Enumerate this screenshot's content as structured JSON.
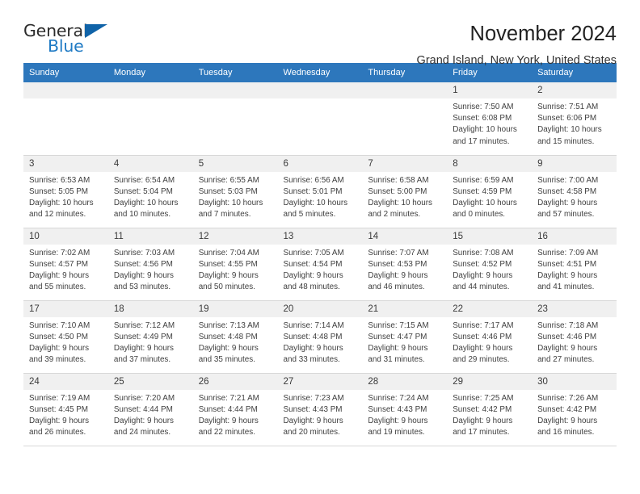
{
  "brand": {
    "name_top": "General",
    "name_bottom": "Blue",
    "triangle_color": "#1063a8",
    "blue_color": "#1f7ac4"
  },
  "header": {
    "title": "November 2024",
    "subtitle": "Grand Island, New York, United States"
  },
  "theme": {
    "header_bg": "#2d77bc",
    "daynum_bg": "#f0f0f0",
    "grid_line": "#d8d8d8",
    "text": "#3f3f3f"
  },
  "weekday_headers": [
    "Sunday",
    "Monday",
    "Tuesday",
    "Wednesday",
    "Thursday",
    "Friday",
    "Saturday"
  ],
  "labels": {
    "sunrise_prefix": "Sunrise:",
    "sunset_prefix": "Sunset:",
    "daylight_prefix": "Daylight:"
  },
  "weeks": [
    [
      {
        "day": "",
        "blank": true
      },
      {
        "day": "",
        "blank": true
      },
      {
        "day": "",
        "blank": true
      },
      {
        "day": "",
        "blank": true
      },
      {
        "day": "",
        "blank": true
      },
      {
        "day": "1",
        "sunrise": "Sunrise: 7:50 AM",
        "sunset": "Sunset: 6:08 PM",
        "daylight_l1": "Daylight: 10 hours",
        "daylight_l2": "and 17 minutes."
      },
      {
        "day": "2",
        "sunrise": "Sunrise: 7:51 AM",
        "sunset": "Sunset: 6:06 PM",
        "daylight_l1": "Daylight: 10 hours",
        "daylight_l2": "and 15 minutes."
      }
    ],
    [
      {
        "day": "3",
        "sunrise": "Sunrise: 6:53 AM",
        "sunset": "Sunset: 5:05 PM",
        "daylight_l1": "Daylight: 10 hours",
        "daylight_l2": "and 12 minutes."
      },
      {
        "day": "4",
        "sunrise": "Sunrise: 6:54 AM",
        "sunset": "Sunset: 5:04 PM",
        "daylight_l1": "Daylight: 10 hours",
        "daylight_l2": "and 10 minutes."
      },
      {
        "day": "5",
        "sunrise": "Sunrise: 6:55 AM",
        "sunset": "Sunset: 5:03 PM",
        "daylight_l1": "Daylight: 10 hours",
        "daylight_l2": "and 7 minutes."
      },
      {
        "day": "6",
        "sunrise": "Sunrise: 6:56 AM",
        "sunset": "Sunset: 5:01 PM",
        "daylight_l1": "Daylight: 10 hours",
        "daylight_l2": "and 5 minutes."
      },
      {
        "day": "7",
        "sunrise": "Sunrise: 6:58 AM",
        "sunset": "Sunset: 5:00 PM",
        "daylight_l1": "Daylight: 10 hours",
        "daylight_l2": "and 2 minutes."
      },
      {
        "day": "8",
        "sunrise": "Sunrise: 6:59 AM",
        "sunset": "Sunset: 4:59 PM",
        "daylight_l1": "Daylight: 10 hours",
        "daylight_l2": "and 0 minutes."
      },
      {
        "day": "9",
        "sunrise": "Sunrise: 7:00 AM",
        "sunset": "Sunset: 4:58 PM",
        "daylight_l1": "Daylight: 9 hours",
        "daylight_l2": "and 57 minutes."
      }
    ],
    [
      {
        "day": "10",
        "sunrise": "Sunrise: 7:02 AM",
        "sunset": "Sunset: 4:57 PM",
        "daylight_l1": "Daylight: 9 hours",
        "daylight_l2": "and 55 minutes."
      },
      {
        "day": "11",
        "sunrise": "Sunrise: 7:03 AM",
        "sunset": "Sunset: 4:56 PM",
        "daylight_l1": "Daylight: 9 hours",
        "daylight_l2": "and 53 minutes."
      },
      {
        "day": "12",
        "sunrise": "Sunrise: 7:04 AM",
        "sunset": "Sunset: 4:55 PM",
        "daylight_l1": "Daylight: 9 hours",
        "daylight_l2": "and 50 minutes."
      },
      {
        "day": "13",
        "sunrise": "Sunrise: 7:05 AM",
        "sunset": "Sunset: 4:54 PM",
        "daylight_l1": "Daylight: 9 hours",
        "daylight_l2": "and 48 minutes."
      },
      {
        "day": "14",
        "sunrise": "Sunrise: 7:07 AM",
        "sunset": "Sunset: 4:53 PM",
        "daylight_l1": "Daylight: 9 hours",
        "daylight_l2": "and 46 minutes."
      },
      {
        "day": "15",
        "sunrise": "Sunrise: 7:08 AM",
        "sunset": "Sunset: 4:52 PM",
        "daylight_l1": "Daylight: 9 hours",
        "daylight_l2": "and 44 minutes."
      },
      {
        "day": "16",
        "sunrise": "Sunrise: 7:09 AM",
        "sunset": "Sunset: 4:51 PM",
        "daylight_l1": "Daylight: 9 hours",
        "daylight_l2": "and 41 minutes."
      }
    ],
    [
      {
        "day": "17",
        "sunrise": "Sunrise: 7:10 AM",
        "sunset": "Sunset: 4:50 PM",
        "daylight_l1": "Daylight: 9 hours",
        "daylight_l2": "and 39 minutes."
      },
      {
        "day": "18",
        "sunrise": "Sunrise: 7:12 AM",
        "sunset": "Sunset: 4:49 PM",
        "daylight_l1": "Daylight: 9 hours",
        "daylight_l2": "and 37 minutes."
      },
      {
        "day": "19",
        "sunrise": "Sunrise: 7:13 AM",
        "sunset": "Sunset: 4:48 PM",
        "daylight_l1": "Daylight: 9 hours",
        "daylight_l2": "and 35 minutes."
      },
      {
        "day": "20",
        "sunrise": "Sunrise: 7:14 AM",
        "sunset": "Sunset: 4:48 PM",
        "daylight_l1": "Daylight: 9 hours",
        "daylight_l2": "and 33 minutes."
      },
      {
        "day": "21",
        "sunrise": "Sunrise: 7:15 AM",
        "sunset": "Sunset: 4:47 PM",
        "daylight_l1": "Daylight: 9 hours",
        "daylight_l2": "and 31 minutes."
      },
      {
        "day": "22",
        "sunrise": "Sunrise: 7:17 AM",
        "sunset": "Sunset: 4:46 PM",
        "daylight_l1": "Daylight: 9 hours",
        "daylight_l2": "and 29 minutes."
      },
      {
        "day": "23",
        "sunrise": "Sunrise: 7:18 AM",
        "sunset": "Sunset: 4:46 PM",
        "daylight_l1": "Daylight: 9 hours",
        "daylight_l2": "and 27 minutes."
      }
    ],
    [
      {
        "day": "24",
        "sunrise": "Sunrise: 7:19 AM",
        "sunset": "Sunset: 4:45 PM",
        "daylight_l1": "Daylight: 9 hours",
        "daylight_l2": "and 26 minutes."
      },
      {
        "day": "25",
        "sunrise": "Sunrise: 7:20 AM",
        "sunset": "Sunset: 4:44 PM",
        "daylight_l1": "Daylight: 9 hours",
        "daylight_l2": "and 24 minutes."
      },
      {
        "day": "26",
        "sunrise": "Sunrise: 7:21 AM",
        "sunset": "Sunset: 4:44 PM",
        "daylight_l1": "Daylight: 9 hours",
        "daylight_l2": "and 22 minutes."
      },
      {
        "day": "27",
        "sunrise": "Sunrise: 7:23 AM",
        "sunset": "Sunset: 4:43 PM",
        "daylight_l1": "Daylight: 9 hours",
        "daylight_l2": "and 20 minutes."
      },
      {
        "day": "28",
        "sunrise": "Sunrise: 7:24 AM",
        "sunset": "Sunset: 4:43 PM",
        "daylight_l1": "Daylight: 9 hours",
        "daylight_l2": "and 19 minutes."
      },
      {
        "day": "29",
        "sunrise": "Sunrise: 7:25 AM",
        "sunset": "Sunset: 4:42 PM",
        "daylight_l1": "Daylight: 9 hours",
        "daylight_l2": "and 17 minutes."
      },
      {
        "day": "30",
        "sunrise": "Sunrise: 7:26 AM",
        "sunset": "Sunset: 4:42 PM",
        "daylight_l1": "Daylight: 9 hours",
        "daylight_l2": "and 16 minutes."
      }
    ]
  ]
}
